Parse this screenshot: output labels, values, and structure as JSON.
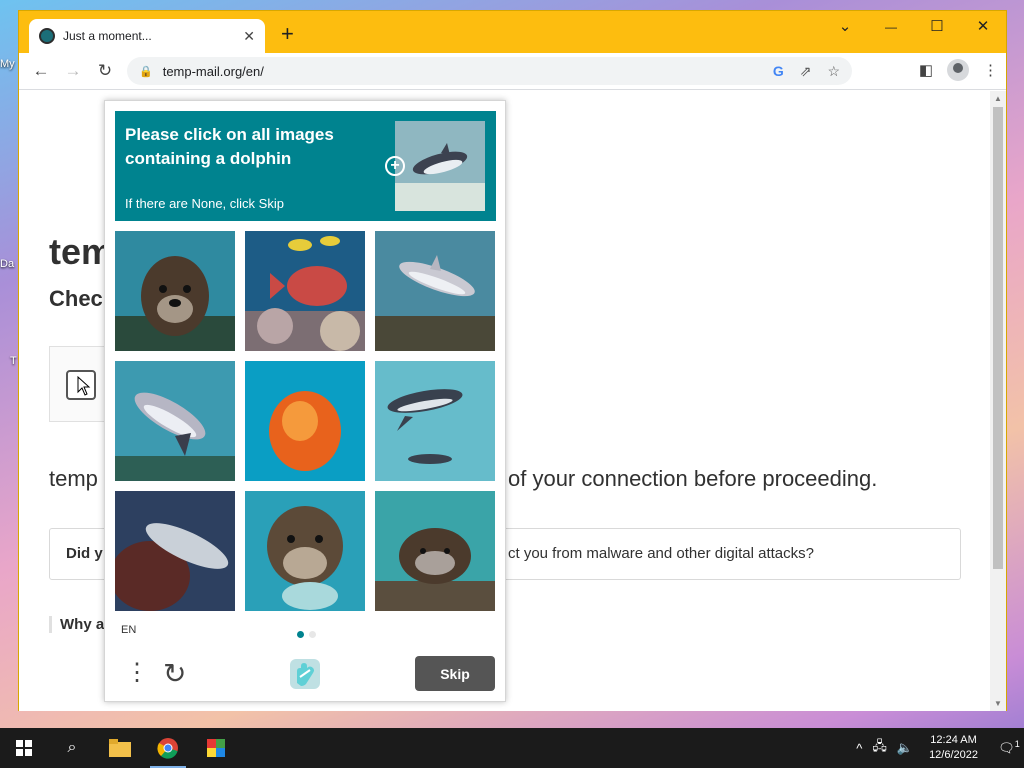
{
  "desktop": {
    "labels": [
      "My",
      "Da",
      "T"
    ]
  },
  "browser": {
    "tab_title": "Just a moment...",
    "url": "temp-mail.org/en/",
    "window_controls": {
      "dropdown": "⌄",
      "minimize": "—",
      "maximize": "☐",
      "close": "✕"
    }
  },
  "page": {
    "heading": "tem",
    "subheading": "Check",
    "text_left": "temp",
    "text_right": "of your connection before proceeding.",
    "faq_q_left": "Did y",
    "faq_q_right": "ct you from malware and other digital attacks?",
    "why": "Why a"
  },
  "captcha": {
    "prompt": "Please click on all images containing a dolphin",
    "hint": "If there are None, click Skip",
    "language": "EN",
    "skip_label": "Skip",
    "page_indicator": {
      "current": 1,
      "total": 2
    },
    "accent_color": "#00838f",
    "grid": [
      {
        "subject": "otter"
      },
      {
        "subject": "fish"
      },
      {
        "subject": "dolphin"
      },
      {
        "subject": "dolphin"
      },
      {
        "subject": "jellyfish"
      },
      {
        "subject": "dolphin"
      },
      {
        "subject": "dolphin"
      },
      {
        "subject": "otter"
      },
      {
        "subject": "otter"
      }
    ]
  },
  "taskbar": {
    "time": "12:24 AM",
    "date": "12/6/2022",
    "notification_count": "1"
  }
}
